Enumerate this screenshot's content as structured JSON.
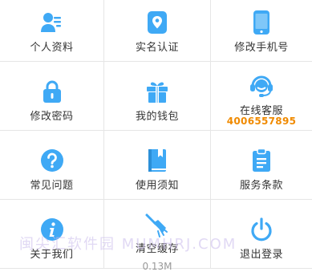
{
  "items": [
    {
      "label": "个人资料",
      "icon": "profile-icon"
    },
    {
      "label": "实名认证",
      "icon": "location-badge-icon"
    },
    {
      "label": "修改手机号",
      "icon": "phone-icon"
    },
    {
      "label": "修改密码",
      "icon": "lock-icon"
    },
    {
      "label": "我的钱包",
      "icon": "gift-icon"
    },
    {
      "label": "在线客服",
      "icon": "headset-icon",
      "phone": "4006557895"
    },
    {
      "label": "常见问题",
      "icon": "question-icon"
    },
    {
      "label": "使用须知",
      "icon": "book-icon"
    },
    {
      "label": "服务条款",
      "icon": "clipboard-icon"
    },
    {
      "label": "关于我们",
      "icon": "info-icon"
    },
    {
      "label": "清空缓存",
      "icon": "broom-icon",
      "sub": "0.13M"
    },
    {
      "label": "退出登录",
      "icon": "power-icon"
    }
  ],
  "watermark": "闽尖汇软件园 MUMHRJ.COM",
  "colors": {
    "icon_blue": "#3fa9f5",
    "phone_orange": "#f08a00"
  }
}
